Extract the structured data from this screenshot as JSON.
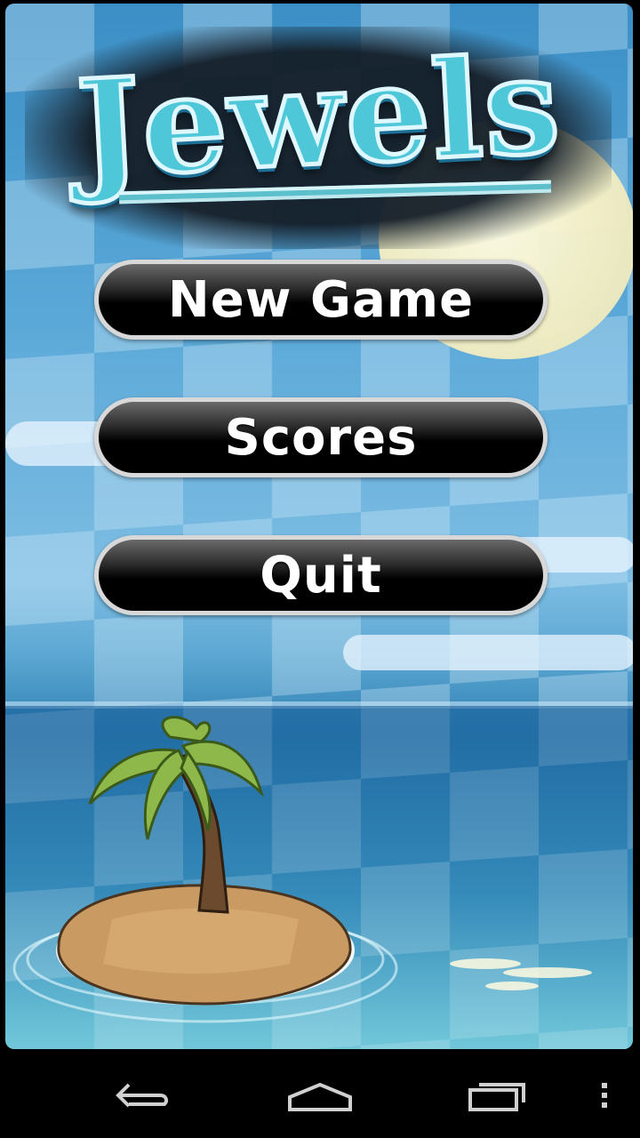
{
  "app": {
    "logo": "Jewels"
  },
  "menu": {
    "buttons": [
      {
        "label": "New Game"
      },
      {
        "label": "Scores"
      },
      {
        "label": "Quit"
      }
    ]
  },
  "navigation_bar": {
    "icons": [
      "back-icon",
      "home-icon",
      "recents-icon",
      "overflow-menu-icon"
    ]
  },
  "colors": {
    "sky": "#5aa8d8",
    "logo_fill": "#4ec7d9",
    "button_bg": "#000000",
    "button_text": "#ffffff",
    "nav_bg": "#000000"
  }
}
